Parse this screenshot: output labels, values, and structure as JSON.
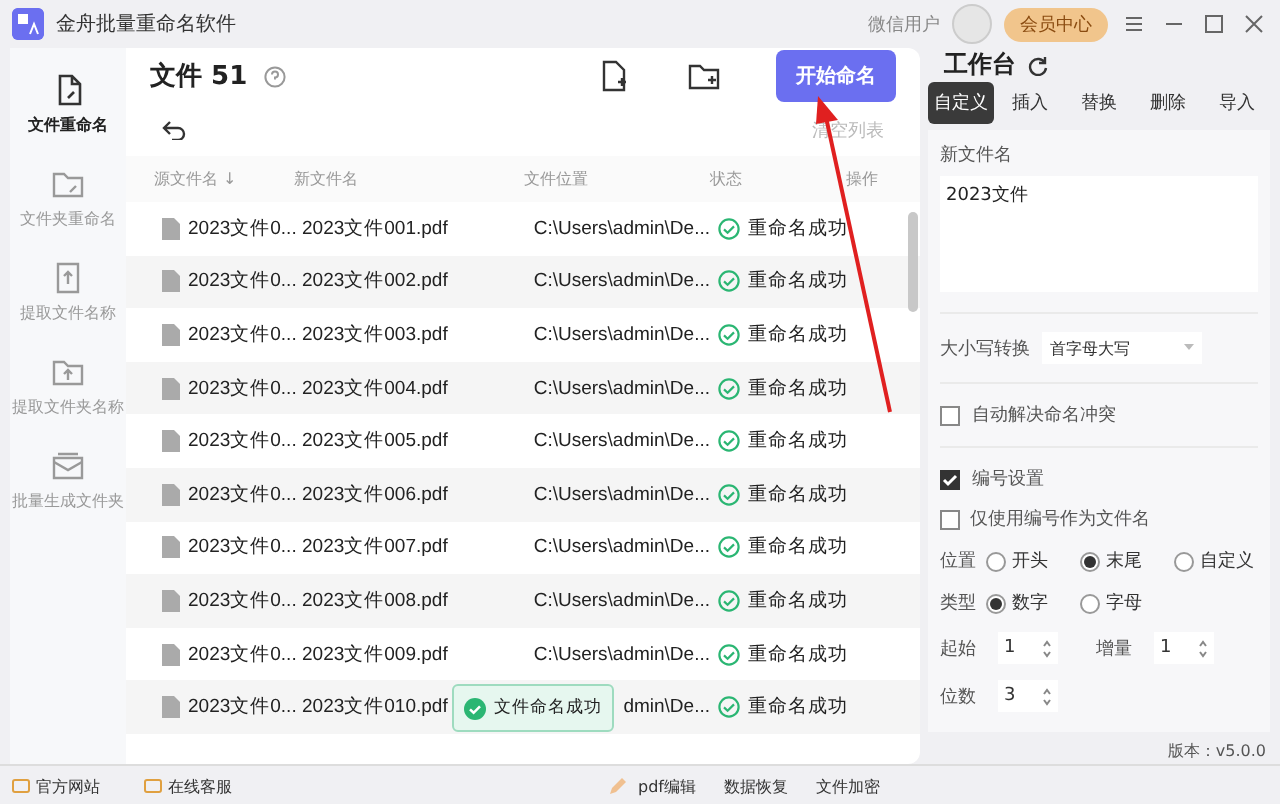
{
  "window": {
    "title": "金舟批量重命名软件",
    "user": "微信用户",
    "vip_button": "会员中心"
  },
  "sidebar": {
    "items": [
      {
        "label": "文件重命名",
        "selected": true
      },
      {
        "label": "文件夹重命名",
        "selected": false
      },
      {
        "label": "提取文件名称",
        "selected": false
      },
      {
        "label": "提取文件夹名称",
        "selected": false
      },
      {
        "label": "批量生成文件夹",
        "selected": false
      }
    ]
  },
  "main": {
    "title": "文件 51",
    "start_button": "开始命名",
    "clear_link": "清空列表"
  },
  "table": {
    "columns": [
      "源文件名 ↓",
      "新文件名",
      "文件位置",
      "状态",
      "操作"
    ],
    "rows": [
      {
        "source": "2023文件0...",
        "new_name": "2023文件001.pdf",
        "location": "C:\\Users\\admin\\De...",
        "status": "重命名成功"
      },
      {
        "source": "2023文件0...",
        "new_name": "2023文件002.pdf",
        "location": "C:\\Users\\admin\\De...",
        "status": "重命名成功"
      },
      {
        "source": "2023文件0...",
        "new_name": "2023文件003.pdf",
        "location": "C:\\Users\\admin\\De...",
        "status": "重命名成功"
      },
      {
        "source": "2023文件0...",
        "new_name": "2023文件004.pdf",
        "location": "C:\\Users\\admin\\De...",
        "status": "重命名成功"
      },
      {
        "source": "2023文件0...",
        "new_name": "2023文件005.pdf",
        "location": "C:\\Users\\admin\\De...",
        "status": "重命名成功"
      },
      {
        "source": "2023文件0...",
        "new_name": "2023文件006.pdf",
        "location": "C:\\Users\\admin\\De...",
        "status": "重命名成功"
      },
      {
        "source": "2023文件0...",
        "new_name": "2023文件007.pdf",
        "location": "C:\\Users\\admin\\De...",
        "status": "重命名成功"
      },
      {
        "source": "2023文件0...",
        "new_name": "2023文件008.pdf",
        "location": "C:\\Users\\admin\\De...",
        "status": "重命名成功"
      },
      {
        "source": "2023文件0...",
        "new_name": "2023文件009.pdf",
        "location": "C:\\Users\\admin\\De...",
        "status": "重命名成功"
      },
      {
        "source": "2023文件0...",
        "new_name": "2023文件010.pdf",
        "location": "dmin\\De...",
        "status": "重命名成功"
      }
    ]
  },
  "toast": {
    "text": "文件命名成功"
  },
  "workbench": {
    "title": "工作台",
    "tabs": [
      {
        "label": "自定义",
        "selected": true
      },
      {
        "label": "插入",
        "selected": false
      },
      {
        "label": "替换",
        "selected": false
      },
      {
        "label": "删除",
        "selected": false
      },
      {
        "label": "导入",
        "selected": false
      }
    ],
    "new_name_label": "新文件名",
    "new_name_value": "2023文件",
    "case_label": "大小写转换",
    "case_value": "首字母大写",
    "auto_conflict": {
      "label": "自动解决命名冲突",
      "checked": false
    },
    "numbering": {
      "label": "编号设置",
      "checked": true
    },
    "number_only": {
      "label": "仅使用编号作为文件名",
      "checked": false
    },
    "position": {
      "label": "位置",
      "options": [
        {
          "label": "开头",
          "selected": false
        },
        {
          "label": "末尾",
          "selected": true
        },
        {
          "label": "自定义",
          "selected": false
        }
      ]
    },
    "type": {
      "label": "类型",
      "options": [
        {
          "label": "数字",
          "selected": true
        },
        {
          "label": "字母",
          "selected": false
        }
      ]
    },
    "start": {
      "label": "起始",
      "value": "1"
    },
    "step": {
      "label": "增量",
      "value": "1"
    },
    "digits": {
      "label": "位数",
      "value": "3"
    }
  },
  "status_bar": {
    "left": [
      "官方网站",
      "在线客服"
    ],
    "center": [
      "pdf编辑",
      "数据恢复",
      "文件加密"
    ],
    "version": "版本：v5.0.0"
  }
}
